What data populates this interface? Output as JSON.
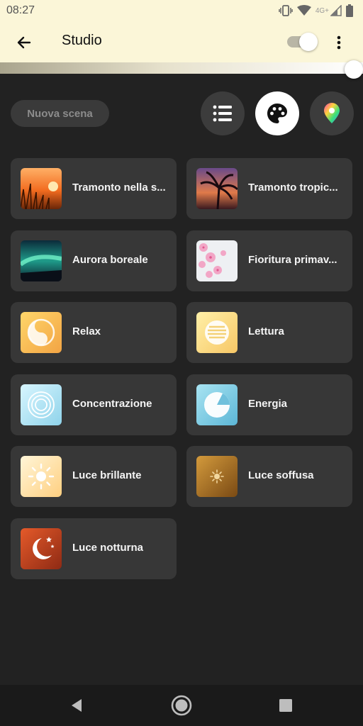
{
  "status_bar": {
    "time": "08:27",
    "network": "4G+"
  },
  "header": {
    "title": "Studio",
    "power_on": true
  },
  "brightness": {
    "level": 1.0
  },
  "controls": {
    "new_scene_label": "Nuova scena"
  },
  "scenes": [
    {
      "label": "Tramonto nella s...",
      "icon": "sunset-grass-image"
    },
    {
      "label": "Tramonto tropic...",
      "icon": "tropical-sunset-palm-image"
    },
    {
      "label": "Aurora boreale",
      "icon": "aurora-image"
    },
    {
      "label": "Fioritura primav...",
      "icon": "cherry-blossom-image"
    },
    {
      "label": "Relax",
      "icon": "relax-yin-yang-icon"
    },
    {
      "label": "Lettura",
      "icon": "reading-lines-icon"
    },
    {
      "label": "Concentrazione",
      "icon": "concentration-rings-icon"
    },
    {
      "label": "Energia",
      "icon": "energy-pie-icon"
    },
    {
      "label": "Luce brillante",
      "icon": "bright-sun-icon"
    },
    {
      "label": "Luce soffusa",
      "icon": "dim-sun-icon"
    },
    {
      "label": "Luce notturna",
      "icon": "moon-stars-icon"
    }
  ],
  "colors": {
    "background": "#222222",
    "header": "#fbf6d8",
    "card": "#373737"
  }
}
